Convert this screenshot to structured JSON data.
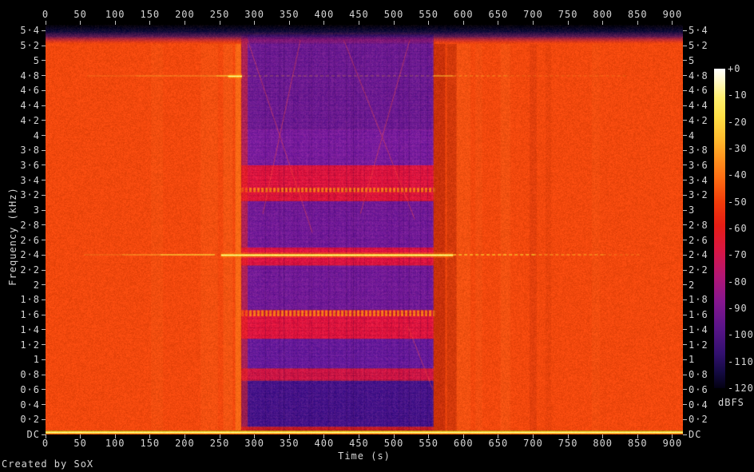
{
  "credit": "Created by SoX",
  "chart_data": {
    "type": "heatmap",
    "title": "",
    "xlabel": "Time (s)",
    "ylabel": "Frequency (kHz)",
    "x_range_s": [
      0,
      915
    ],
    "y_range_khz": [
      0,
      5.48
    ],
    "grid": false,
    "x_ticks": {
      "values": [
        0,
        50,
        100,
        150,
        200,
        250,
        300,
        350,
        400,
        450,
        500,
        550,
        600,
        650,
        700,
        750,
        800,
        850,
        900
      ],
      "labels": [
        "0",
        "50",
        "100",
        "150",
        "200",
        "250",
        "300",
        "350",
        "400",
        "450",
        "500",
        "550",
        "600",
        "650",
        "700",
        "750",
        "800",
        "850",
        "900"
      ]
    },
    "y_ticks": {
      "values": [
        5.4,
        5.2,
        5.0,
        4.8,
        4.6,
        4.4,
        4.2,
        4.0,
        3.8,
        3.6,
        3.4,
        3.2,
        3.0,
        2.8,
        2.6,
        2.4,
        2.2,
        2.0,
        1.8,
        1.6,
        1.4,
        1.2,
        1.0,
        0.8,
        0.6,
        0.4,
        0.2,
        0
      ],
      "labels": [
        "5·4",
        "5·2",
        "5",
        "4·8",
        "4·6",
        "4·4",
        "4·2",
        "4",
        "3·8",
        "3·6",
        "3·4",
        "3·2",
        "3",
        "2·8",
        "2·6",
        "2·4",
        "2·2",
        "2",
        "1·8",
        "1·6",
        "1·4",
        "1·2",
        "1",
        "0·8",
        "0·6",
        "0·4",
        "0·2",
        "DC"
      ]
    },
    "colorbar": {
      "label": "dBFS",
      "tick_labels": [
        "+0",
        "-10",
        "-20",
        "-30",
        "-40",
        "-50",
        "-60",
        "-70",
        "-80",
        "-90",
        "-100",
        "-110",
        "-120"
      ],
      "gradient": [
        [
          "#ffffff",
          0
        ],
        [
          "#fff8c4",
          0.04
        ],
        [
          "#ffef70",
          0.09
        ],
        [
          "#ffdf45",
          0.15
        ],
        [
          "#ffbb2e",
          0.22
        ],
        [
          "#ff931e",
          0.28
        ],
        [
          "#fd6812",
          0.35
        ],
        [
          "#f23b0a",
          0.42
        ],
        [
          "#e61d14",
          0.49
        ],
        [
          "#d81644",
          0.57
        ],
        [
          "#b21675",
          0.65
        ],
        [
          "#85168f",
          0.73
        ],
        [
          "#5a1489",
          0.81
        ],
        [
          "#331070",
          0.89
        ],
        [
          "#140a42",
          0.95
        ],
        [
          "#030112",
          1
        ]
      ]
    },
    "features": {
      "base_color": "#f2480d",
      "nyquist_band": {
        "f_bottom": 5.22,
        "stops": [
          [
            "rgba(0,0,6,1)",
            0
          ],
          [
            "rgba(10,10,58,0.97)",
            0.35
          ],
          [
            "rgba(56,16,100,0.82)",
            0.6
          ],
          [
            "rgba(150,18,85,0.45)",
            0.8
          ],
          [
            "rgba(200,30,30,0)",
            1
          ]
        ]
      },
      "signal_region": {
        "t0": 281,
        "t1": 557,
        "bands": [
          {
            "f0": 5.35,
            "f1": 4.08,
            "color": "#6d1a92"
          },
          {
            "f0": 4.08,
            "f1": 3.6,
            "color": "#7a1c9e"
          },
          {
            "f0": 3.6,
            "f1": 3.3,
            "color": "#e0143e"
          },
          {
            "f0": 3.3,
            "f1": 3.24,
            "color": "#ff7a16",
            "dotted": true
          },
          {
            "f0": 3.24,
            "f1": 3.12,
            "color": "#dd1438"
          },
          {
            "f0": 3.12,
            "f1": 2.5,
            "color": "#731a98"
          },
          {
            "f0": 2.5,
            "f1": 2.26,
            "color": "#df1340"
          },
          {
            "f0": 2.26,
            "f1": 1.66,
            "color": "#731a98"
          },
          {
            "f0": 1.66,
            "f1": 1.58,
            "color": "#ff7a16",
            "dotted": true
          },
          {
            "f0": 1.58,
            "f1": 1.28,
            "color": "#e0143e"
          },
          {
            "f0": 1.28,
            "f1": 0.88,
            "color": "#681a9c"
          },
          {
            "f0": 0.88,
            "f1": 0.72,
            "color": "#d01544"
          },
          {
            "f0": 0.72,
            "f1": 0.1,
            "color": "#47138a"
          },
          {
            "f0": 0.1,
            "f1": 0.03,
            "color": "#c81a22"
          }
        ],
        "diagonals": [
          [
            290,
            5.28,
            383,
            2.7
          ],
          [
            312,
            2.95,
            366,
            5.28
          ],
          [
            428,
            5.28,
            530,
            2.88
          ],
          [
            452,
            2.95,
            523,
            5.28
          ],
          [
            520,
            1.45,
            556,
            0.6
          ]
        ]
      },
      "tones": [
        {
          "f": 4.8,
          "segments": [
            [
              60,
              130,
              0.15,
              0
            ],
            [
              130,
              245,
              0.3,
              0
            ],
            [
              245,
              262,
              0.7,
              0
            ],
            [
              262,
              282,
              1,
              0
            ],
            [
              282,
              557,
              0.18,
              1
            ],
            [
              557,
              585,
              0.55,
              0
            ],
            [
              585,
              660,
              0.3,
              1
            ],
            [
              660,
              830,
              0.15,
              1
            ]
          ]
        },
        {
          "f": 2.4,
          "segments": [
            [
              55,
              110,
              0.18,
              0
            ],
            [
              110,
              165,
              0.4,
              0
            ],
            [
              165,
              243,
              0.8,
              0
            ],
            [
              252,
              585,
              1,
              0
            ],
            [
              585,
              700,
              0.75,
              1
            ],
            [
              700,
              800,
              0.45,
              1
            ],
            [
              800,
              855,
              0.2,
              1
            ]
          ]
        }
      ],
      "dc_line": {
        "color": "#ffd929",
        "highlight": "#fff3a0",
        "shadow": "#b87a10"
      },
      "streaks": [
        {
          "t": 160,
          "w": 18,
          "mode": "light",
          "a": 0.05
        },
        {
          "t": 235,
          "w": 25,
          "mode": "light",
          "a": 0.08
        },
        {
          "t": 262,
          "w": 14,
          "mode": "light",
          "a": 0.12
        },
        {
          "t": 276,
          "w": 8,
          "mode": "light",
          "a": 0.2
        },
        {
          "t": 583,
          "w": 14,
          "mode": "dark",
          "a": 0.25
        },
        {
          "t": 600,
          "w": 20,
          "mode": "light",
          "a": 0.1
        },
        {
          "t": 622,
          "w": 10,
          "mode": "light",
          "a": 0.06
        },
        {
          "t": 660,
          "w": 14,
          "mode": "light",
          "a": 0.1
        },
        {
          "t": 700,
          "w": 10,
          "mode": "dark",
          "a": 0.12
        },
        {
          "t": 722,
          "w": 8,
          "mode": "dark",
          "a": 0.08
        },
        {
          "t": 790,
          "w": 12,
          "mode": "light",
          "a": 0.05
        }
      ]
    }
  }
}
